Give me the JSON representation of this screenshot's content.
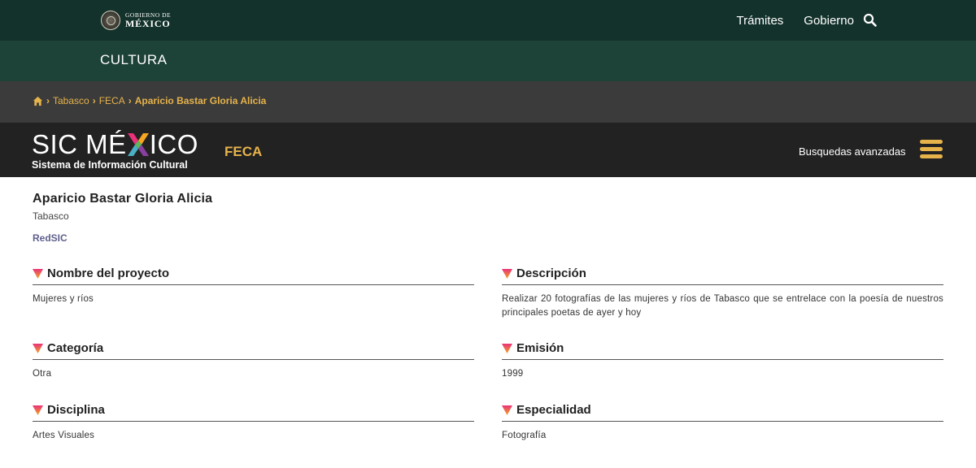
{
  "gov": {
    "logo_small": "GOBIERNO DE",
    "logo_big": "MÉXICO",
    "nav": [
      "Trámites",
      "Gobierno"
    ]
  },
  "section_title": "CULTURA",
  "breadcrumb": {
    "items": [
      "Tabasco",
      "FECA"
    ],
    "current": "Aparicio Bastar Gloria Alicia"
  },
  "sic": {
    "logo_main_pre": "SIC MÉ",
    "logo_main_post": "ICO",
    "logo_sub": "Sistema de Información Cultural",
    "section": "FECA",
    "advanced_search": "Busquedas avanzadas"
  },
  "record": {
    "name": "Aparicio Bastar Gloria Alicia",
    "state": "Tabasco",
    "network_link": "RedSIC",
    "fields": [
      {
        "label": "Nombre del proyecto",
        "value": "Mujeres y ríos"
      },
      {
        "label": "Descripción",
        "value": "Realizar 20 fotografías de las mujeres y ríos de Tabasco que se entrelace con la poesía de nuestros principales poetas de ayer y hoy"
      },
      {
        "label": "Categoría",
        "value": "Otra"
      },
      {
        "label": "Emisión",
        "value": "1999"
      },
      {
        "label": "Disciplina",
        "value": "Artes Visuales"
      },
      {
        "label": "Especialidad",
        "value": "Fotografía"
      }
    ]
  },
  "colors": {
    "gov_green": "#13322b",
    "sub_green": "#1d4238",
    "breadcrumb_gray": "#3b3b3b",
    "sic_dark": "#222222",
    "gold": "#e6b34b",
    "link_purple": "#5f5f8c"
  }
}
